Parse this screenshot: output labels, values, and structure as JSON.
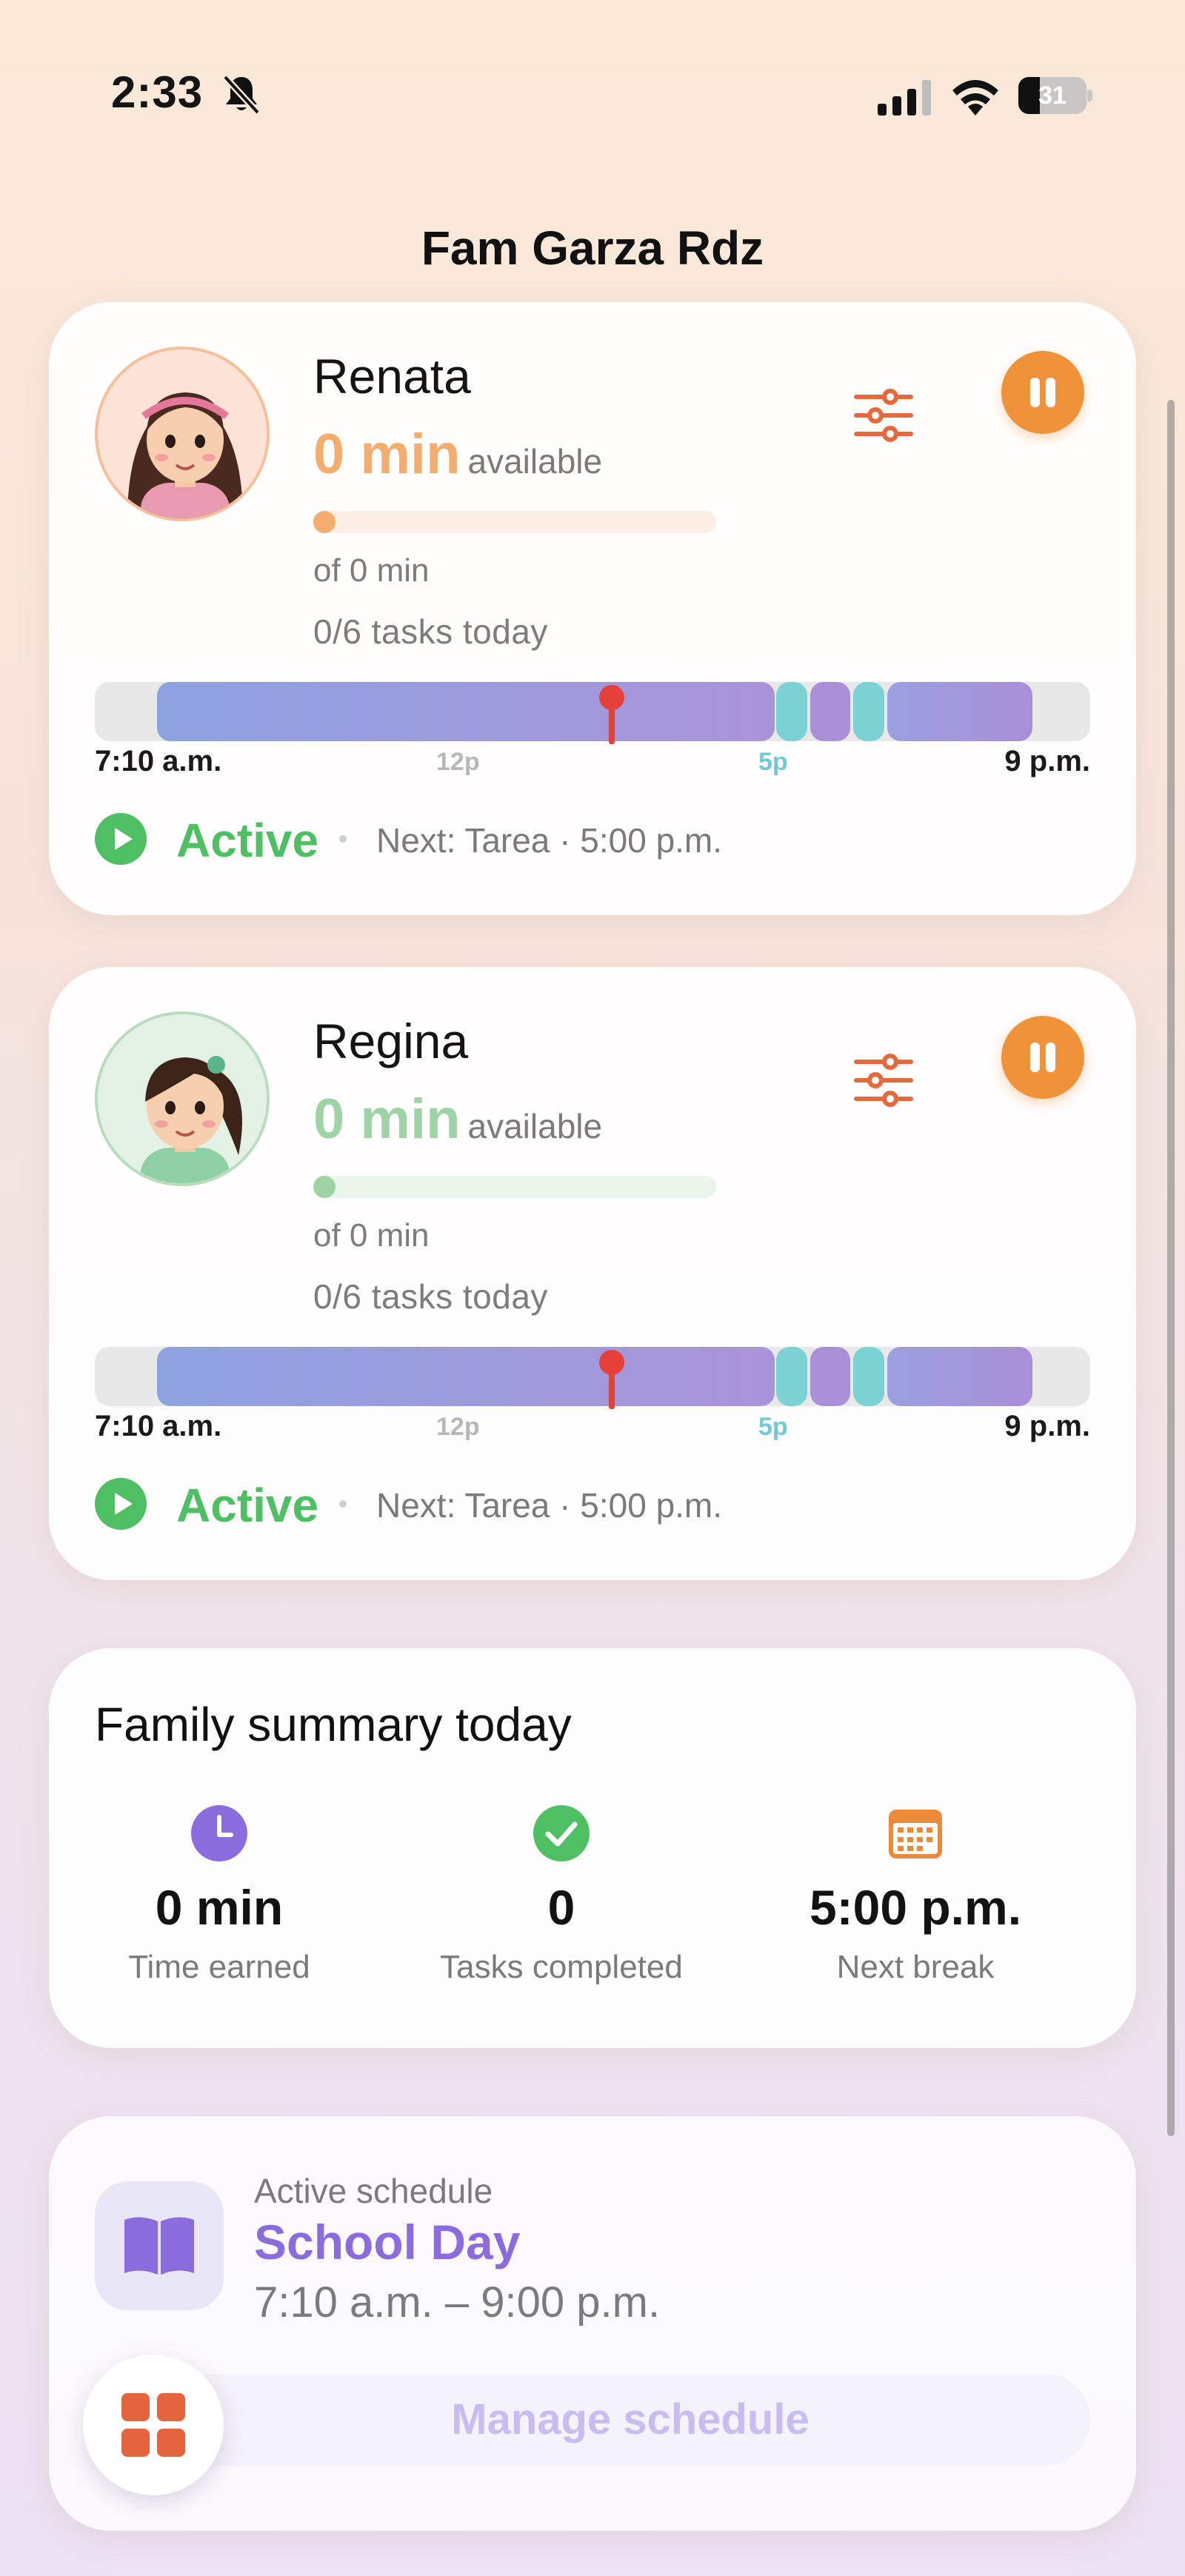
{
  "status_bar": {
    "time": "2:33",
    "battery_level": "31",
    "battery_fraction": 0.31,
    "icons": [
      "bell-slash-icon",
      "cellular-signal-icon",
      "wifi-icon",
      "battery-icon"
    ]
  },
  "family": {
    "title": "Fam Garza Rdz"
  },
  "children": [
    {
      "name": "Renata",
      "minutes": "0 min",
      "minutes_label": "available",
      "progress_fraction": 0,
      "of_text": "of 0 min",
      "tasks_text": "0/6  tasks today",
      "accent_color": "#f3ad6f",
      "track_color": "#fbeee2",
      "timeline": {
        "start_label": "7:10 a.m.",
        "noon_label": "12p",
        "five_label": "5p",
        "end_label": "9 p.m."
      },
      "status": "Active",
      "next": "Next: Tarea · 5:00 p.m."
    },
    {
      "name": "Regina",
      "minutes": "0 min",
      "minutes_label": "available",
      "progress_fraction": 0,
      "of_text": "of 0 min",
      "tasks_text": "0/6  tasks today",
      "accent_color": "#9ed3a5",
      "track_color": "#e9f5ea",
      "timeline": {
        "start_label": "7:10 a.m.",
        "noon_label": "12p",
        "five_label": "5p",
        "end_label": "9 p.m."
      },
      "status": "Active",
      "next": "Next: Tarea · 5:00 p.m."
    }
  ],
  "summary": {
    "title": "Family summary today",
    "items": [
      {
        "icon": "clock-icon",
        "value": "0 min",
        "label": "Time earned",
        "color": "#8b6cdc"
      },
      {
        "icon": "checkmark-icon",
        "value": "0",
        "label": "Tasks completed",
        "color": "#4fbf63"
      },
      {
        "icon": "calendar-icon",
        "value": "5:00 p.m.",
        "label": "Next break",
        "color": "#ec8a3a"
      }
    ]
  },
  "schedule": {
    "label": "Active schedule",
    "name": "School Day",
    "time_range": "7:10 a.m. – 9:00 p.m.",
    "manage_label": "Manage schedule",
    "icon": "book-icon"
  },
  "fab_icon": "grid-icon",
  "colors": {
    "pause_button": "#f0923a",
    "active_green": "#4fbf63",
    "schedule_purple": "#8b6cdc",
    "now_marker": "#e5403a",
    "timeline_teal": "#6ecbd6"
  }
}
